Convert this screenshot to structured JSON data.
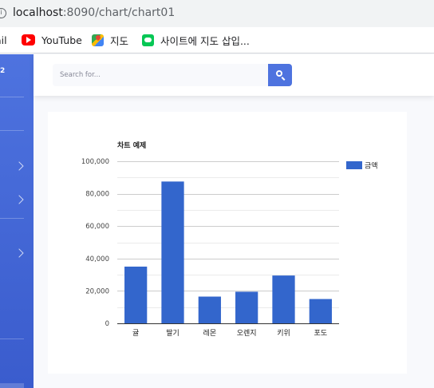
{
  "browser": {
    "url_host": "localhost",
    "url_path": ":8090/chart/chart01",
    "info_icon_glyph": "i"
  },
  "bookmarks": [
    {
      "label": "ail",
      "icon": "gmail-icon"
    },
    {
      "label": "YouTube",
      "icon": "youtube-icon"
    },
    {
      "label": "지도",
      "icon": "maps-icon"
    },
    {
      "label": "사이트에 지도 삽입...",
      "icon": "line-icon"
    }
  ],
  "sidebar": {
    "brand_fragment": "2",
    "color_top": "#4e73df",
    "color_bottom": "#3a5ccd"
  },
  "topbar": {
    "search_placeholder": "Search for...",
    "search_button_color": "#4e73df"
  },
  "chart_data": {
    "type": "bar",
    "title": "차트 예제",
    "categories": [
      "귤",
      "딸기",
      "레몬",
      "오렌지",
      "키위",
      "포도"
    ],
    "series": [
      {
        "name": "금액",
        "color": "#3366cc",
        "values": [
          35000,
          87500,
          16500,
          19500,
          29500,
          15000
        ]
      }
    ],
    "ylim": [
      0,
      100000
    ],
    "yticks": [
      0,
      20000,
      40000,
      60000,
      80000,
      100000
    ],
    "ytick_labels": [
      "0",
      "20,000",
      "40,000",
      "60,000",
      "80,000",
      "100,000"
    ],
    "xlabel": "",
    "ylabel": "",
    "grid": true,
    "legend_position": "right"
  }
}
